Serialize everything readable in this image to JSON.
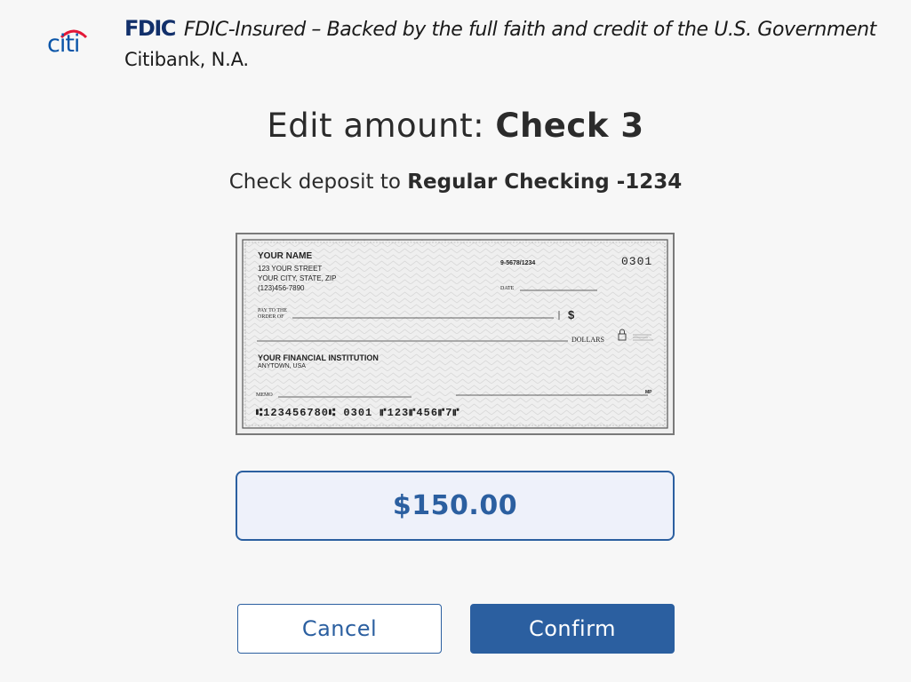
{
  "header": {
    "logo_text": "citi",
    "fdic_mark": "FDIC",
    "fdic_text": "FDIC-Insured – Backed by the full faith and credit of the U.S. Government",
    "bank_name": "Citibank, N.A."
  },
  "title": {
    "prefix": "Edit amount: ",
    "check_label": "Check 3"
  },
  "subtitle": {
    "prefix": "Check deposit to ",
    "account": "Regular Checking -1234"
  },
  "check_image": {
    "name": "YOUR NAME",
    "address_line1": "123 YOUR STREET",
    "address_line2": "YOUR CITY, STATE, ZIP",
    "phone": "(123)456-7890",
    "routing_fraction": "9-5678/1234",
    "check_number": "0301",
    "date_label": "DATE",
    "pay_label_1": "PAY TO THE",
    "pay_label_2": "ORDER OF",
    "dollar_sign": "$",
    "dollars_label": "DOLLARS",
    "bank_name": "YOUR FINANCIAL INSTITUTION",
    "bank_city": "ANYTOWN, USA",
    "memo_label": "MEMO",
    "mp_label": "MP",
    "micr_line": "⑆123456780⑆ 0301 ⑈123⑈456⑈7⑈"
  },
  "amount": {
    "value": "$150.00"
  },
  "buttons": {
    "cancel": "Cancel",
    "confirm": "Confirm"
  },
  "colors": {
    "accent": "#2b5fa0",
    "amount_bg": "#eef1fa",
    "citi_blue": "#0a55a8",
    "citi_arc": "#e31837",
    "fdic_navy": "#12306b",
    "background": "#f7f7f7"
  }
}
